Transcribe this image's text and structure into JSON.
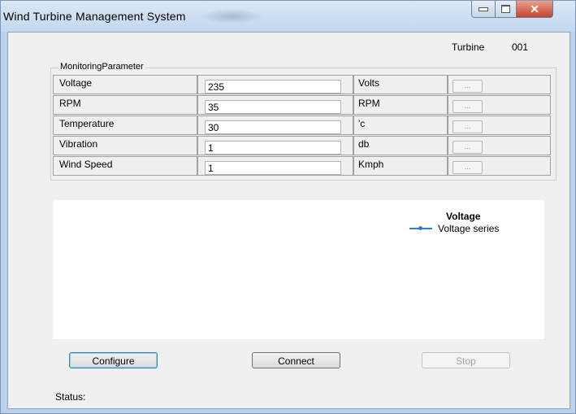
{
  "window": {
    "title": "Wind Turbine  Management System"
  },
  "header": {
    "turbine_label": "Turbine",
    "turbine_id": "001"
  },
  "monitoring": {
    "caption": "MonitoringParameter",
    "rows": [
      {
        "label": "Voltage",
        "value": "235",
        "unit": "Volts",
        "button": "..."
      },
      {
        "label": "RPM",
        "value": "35",
        "unit": "RPM",
        "button": "..."
      },
      {
        "label": "Temperature",
        "value": "30",
        "unit": "'c",
        "button": "..."
      },
      {
        "label": "Vibration",
        "value": "1",
        "unit": "db",
        "button": "..."
      },
      {
        "label": "Wind Speed",
        "value": "1",
        "unit": "Kmph",
        "button": "..."
      }
    ]
  },
  "chart": {
    "legend_title": "Voltage",
    "series_name": "Voltage series",
    "series_color": "#2f7fd5"
  },
  "actions": {
    "configure": "Configure",
    "connect": "Connect",
    "stop": "Stop"
  },
  "status": {
    "label": "Status:"
  }
}
